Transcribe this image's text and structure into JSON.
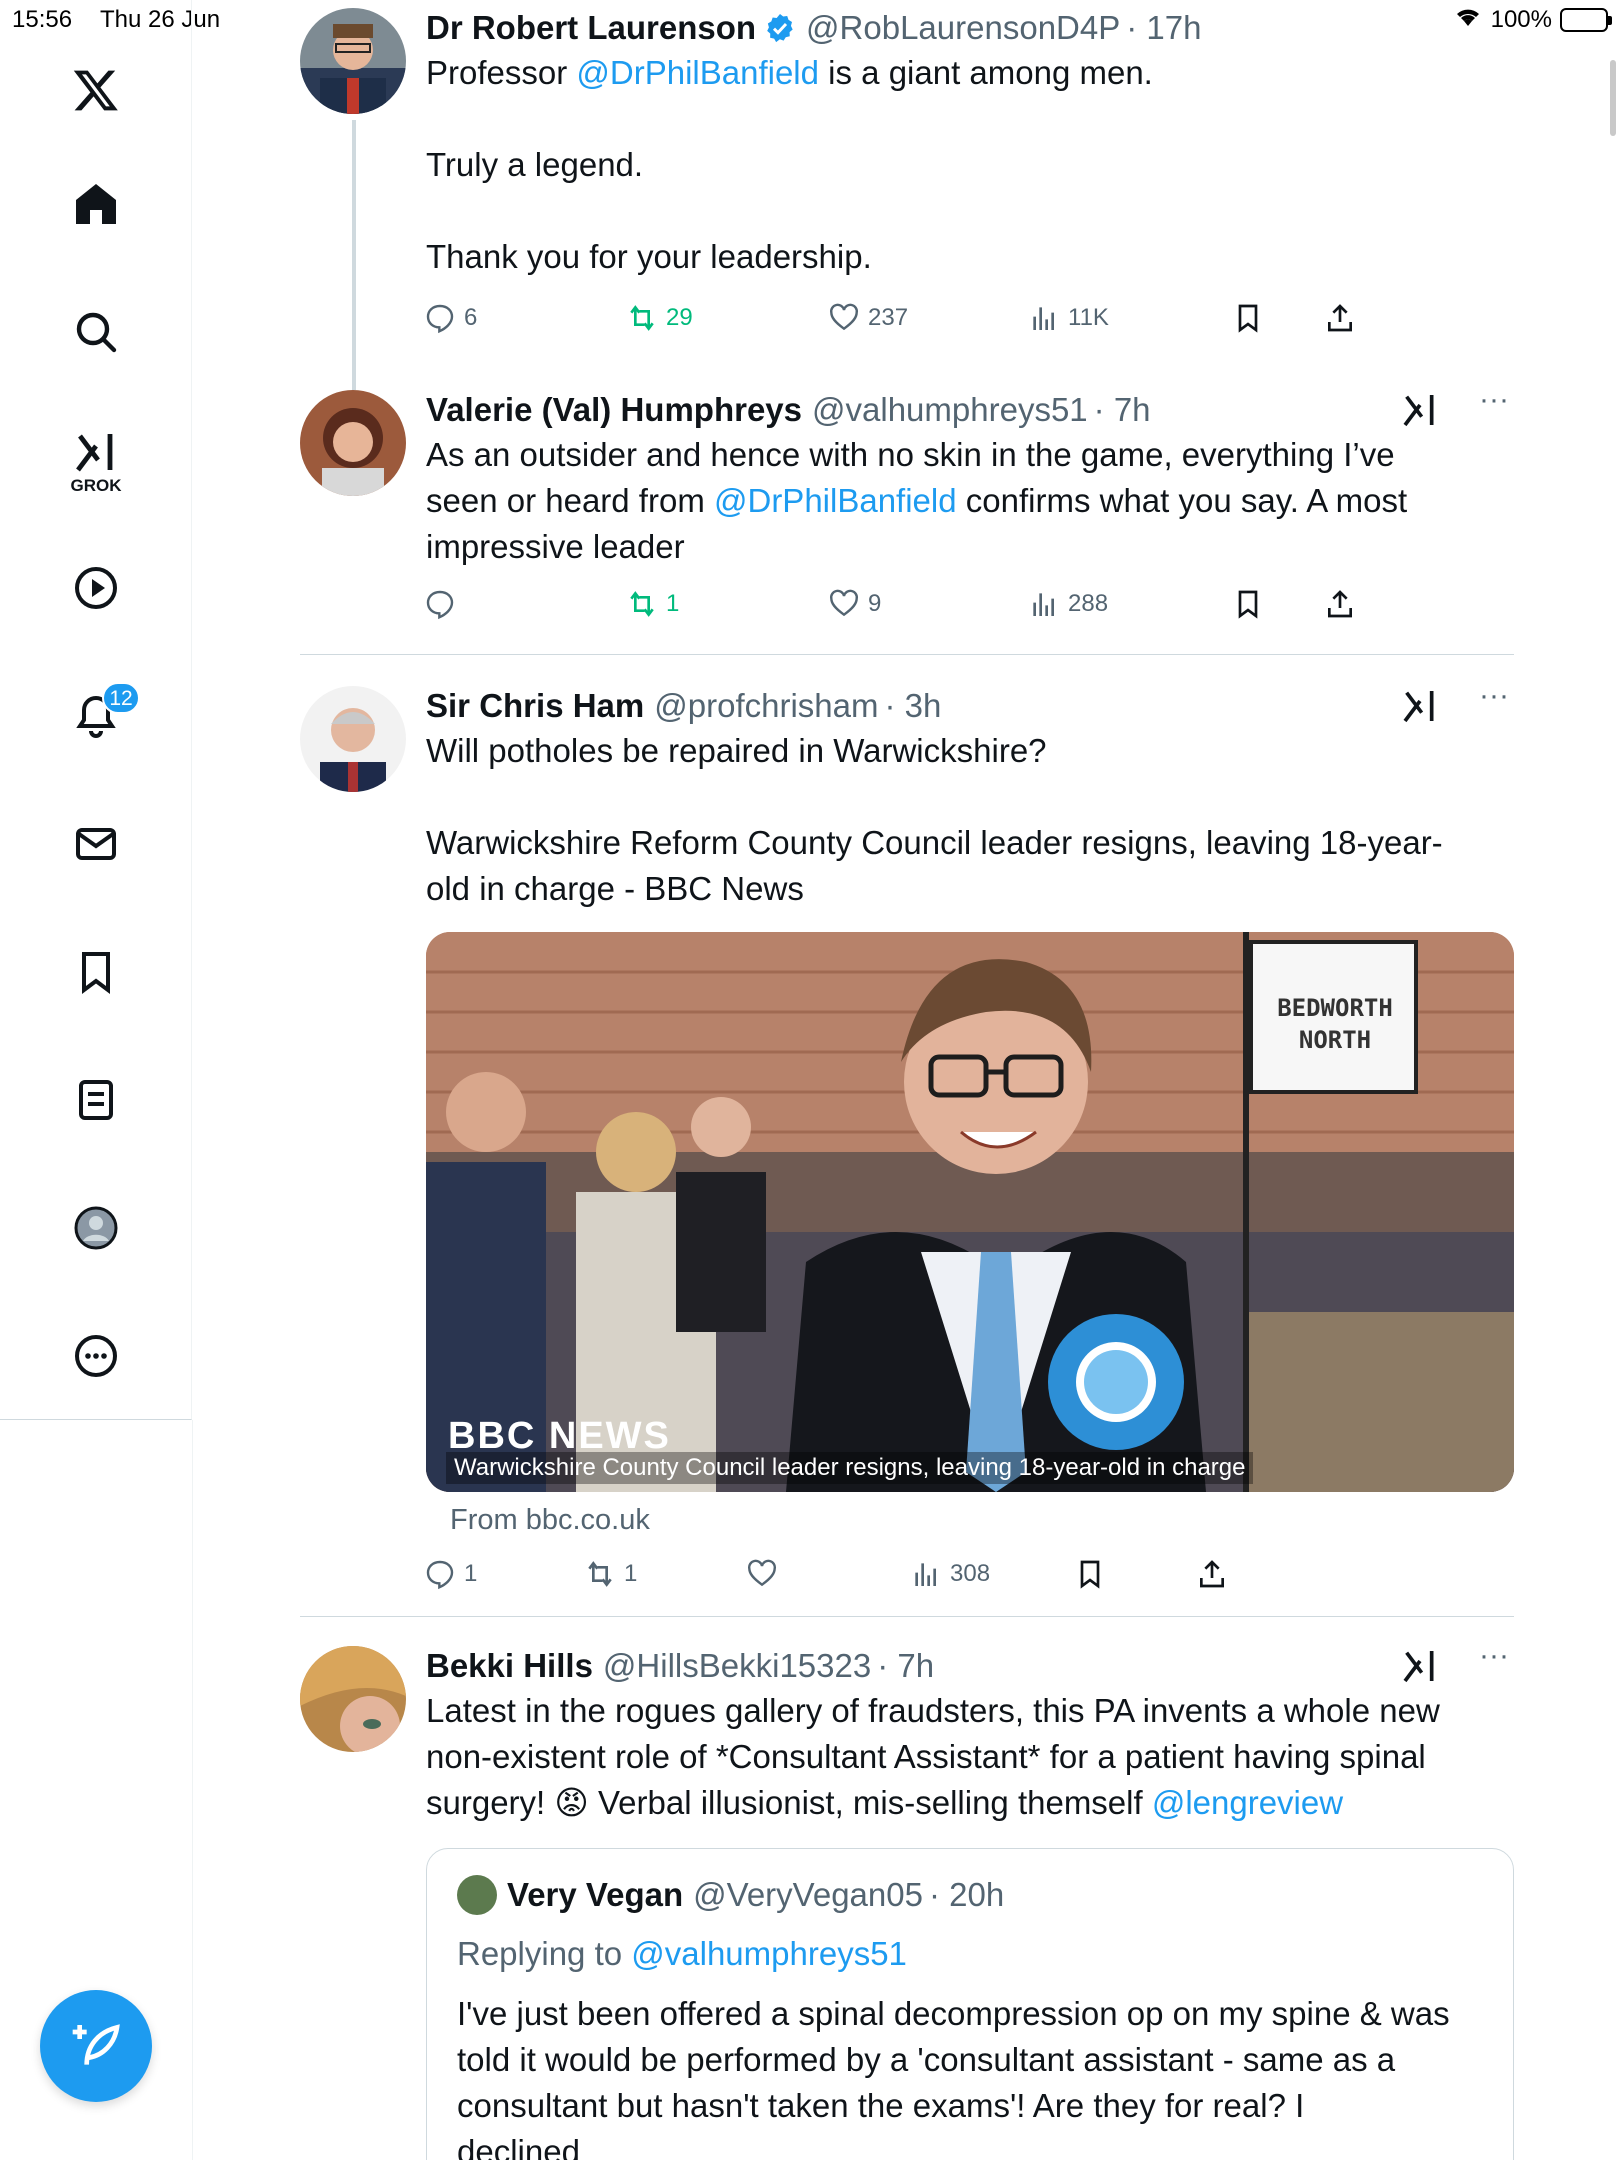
{
  "status_bar": {
    "time": "15:56",
    "date": "Thu 26 Jun",
    "battery": "100%"
  },
  "sidebar": {
    "items": [
      {
        "label": "X",
        "icon": "x-logo-icon"
      },
      {
        "label": "Home",
        "icon": "home-icon"
      },
      {
        "label": "Search",
        "icon": "search-icon"
      },
      {
        "label": "GROK",
        "icon": "grok-icon"
      },
      {
        "label": "Video",
        "icon": "play-icon"
      },
      {
        "label": "Notifications",
        "icon": "bell-icon"
      },
      {
        "label": "Messages",
        "icon": "mail-icon"
      },
      {
        "label": "Bookmarks",
        "icon": "bookmark-icon"
      },
      {
        "label": "Lists",
        "icon": "list-icon"
      },
      {
        "label": "Profile",
        "icon": "profile-icon"
      },
      {
        "label": "More",
        "icon": "more-icon"
      }
    ],
    "grok_label": "GROK",
    "notifications_badge": "12",
    "compose_icon": "compose-icon"
  },
  "posts": [
    {
      "name": "Dr Robert Laurenson",
      "verified": true,
      "handle": "@RobLaurensonD4P",
      "time": "· 17h",
      "line1_pre": "Professor ",
      "line1_mention": "@DrPhilBanfield",
      "line1_post": " is a giant among men.",
      "line2": "Truly a legend.",
      "line3": "Thank you for your leadership.",
      "replies": "6",
      "reposts": "29",
      "likes": "237",
      "views": "11K"
    },
    {
      "name": "Valerie (Val) Humphreys",
      "handle": "@valhumphreys51",
      "time": "· 7h",
      "line1": "As an outsider and hence with no skin in the game, everything I’ve",
      "line2_pre": "seen or heard from ",
      "line2_mention": "@DrPhilBanfield",
      "line2_post": " confirms what you say. A most",
      "line3": "impressive leader",
      "replies": "",
      "reposts": "1",
      "likes": "9",
      "views": "288"
    },
    {
      "name": "Sir Chris Ham",
      "handle": "@profchrisham",
      "time": "· 3h",
      "line1": "Will potholes be repaired in Warwickshire?",
      "line2": "Warwickshire Reform County Council leader resigns, leaving 18-year-",
      "line3": "old in charge - BBC News",
      "media_caption": "Warwickshire County Council leader resigns, leaving 18-year-old in charge",
      "media_sign_1": "BEDWORTH",
      "media_sign_2": "NORTH",
      "media_brand": "BBC NEWS",
      "from": "From bbc.co.uk",
      "replies": "1",
      "reposts": "1",
      "likes": "",
      "views": "308"
    },
    {
      "name": "Bekki Hills",
      "handle": "@HillsBekki15323",
      "time": "· 7h",
      "line1": "Latest in the rogues gallery of fraudsters, this PA invents a whole new",
      "line2": "non-existent role of *Consultant Assistant* for a patient having spinal",
      "line3_pre": "surgery! ",
      "line3_emoji": "😡",
      "line3_mid": " Verbal illusionist, mis-selling themself ",
      "line3_mention": "@lengreview",
      "quote": {
        "name": "Very Vegan",
        "handle": "@VeryVegan05",
        "time": "· 20h",
        "replying_pre": "Replying to ",
        "replying_mention": "@valhumphreys51",
        "line1": "I've just been offered a spinal decompression op on my spine & was",
        "line2": "told it would be performed by a 'consultant assistant - same as a",
        "line3": "consultant but hasn't taken the exams'! Are they for real? I",
        "line4": "declined"
      }
    }
  ]
}
